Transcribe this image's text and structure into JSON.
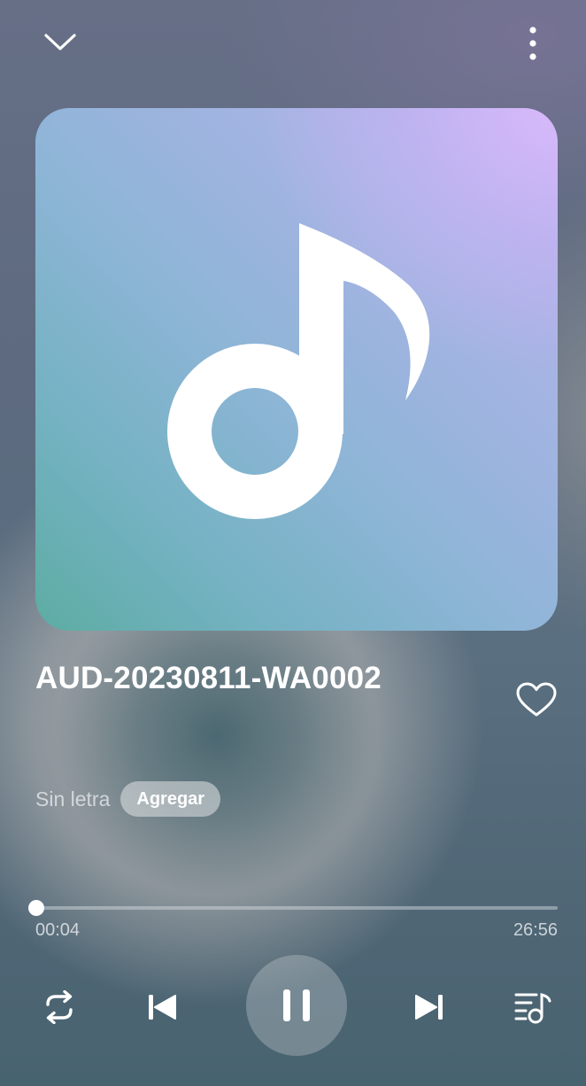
{
  "player": {
    "track_title": "AUD-20230811-WA0002",
    "lyrics_label": "Sin letra",
    "add_lyrics_label": "Agregar",
    "favorite": false,
    "is_playing": true,
    "repeat_mode": "repeat-all"
  },
  "progress": {
    "current_time": "00:04",
    "total_time": "26:56",
    "fraction": 0.0025
  },
  "icons": {
    "collapse": "chevron-down-icon",
    "menu": "more-vertical-icon",
    "art": "music-note-icon",
    "favorite": "heart-outline-icon",
    "repeat": "repeat-icon",
    "previous": "skip-previous-icon",
    "pause": "pause-icon",
    "next": "skip-next-icon",
    "queue": "playlist-icon"
  },
  "colors": {
    "accent": "#ffffff",
    "art_gradient_start": "#5daca3",
    "art_gradient_end": "#d7b9fa"
  }
}
